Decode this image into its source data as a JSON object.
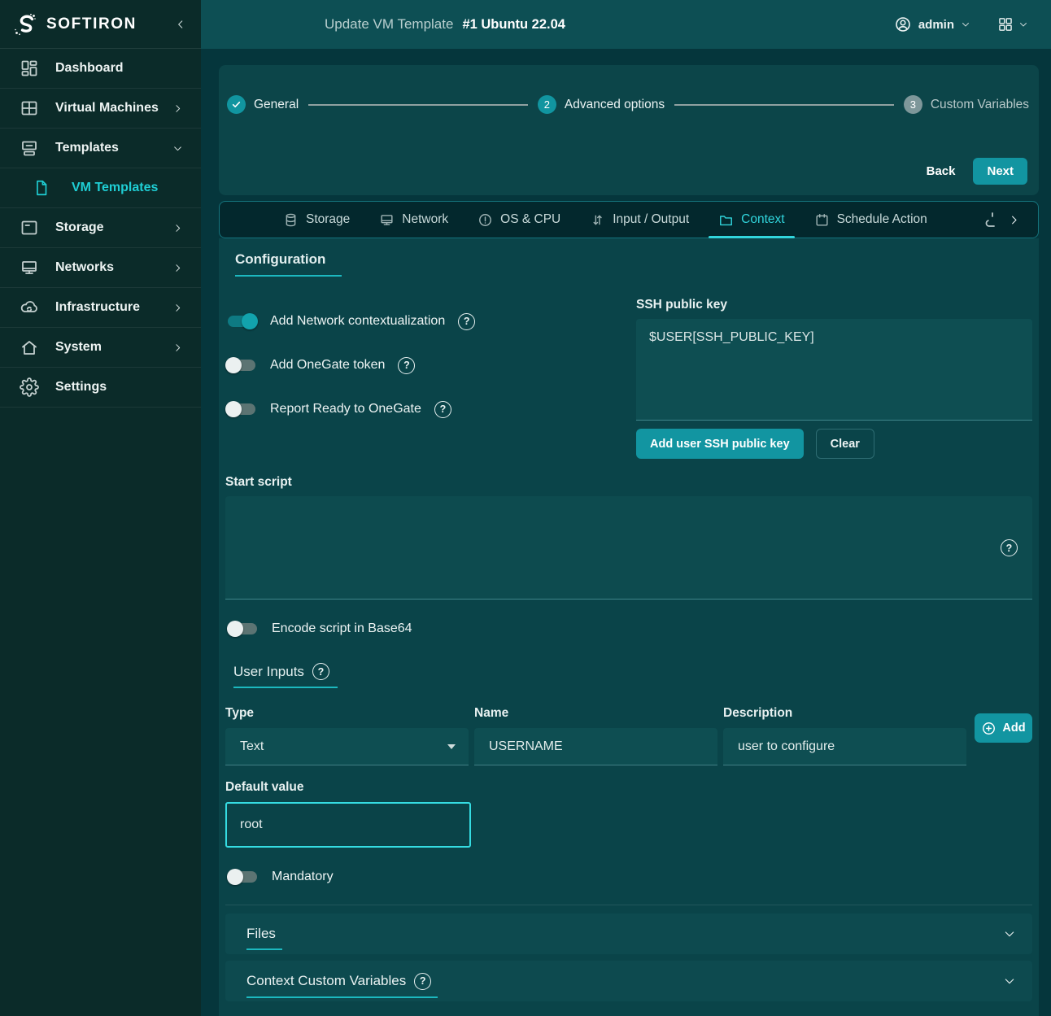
{
  "colors": {
    "accent": "#1295a1",
    "accent_bright": "#31d5dc",
    "focus_border": "#35dce2",
    "underline": "#1cb8bf",
    "sidebar_bg": "#0b2b29",
    "header_bg": "#0d4f54",
    "page_bg": "#05363c",
    "panel_bg": "#0a4449",
    "tabbar_bg": "#03282d"
  },
  "sidebar": {
    "brand": "SOFTIRON",
    "items": [
      {
        "label": "Dashboard",
        "icon": "dashboard-icon",
        "expandable": false,
        "active": false
      },
      {
        "label": "Virtual Machines",
        "icon": "vm-icon",
        "expandable": true,
        "active": false
      },
      {
        "label": "Templates",
        "icon": "templates-icon",
        "expandable": true,
        "expanded": true,
        "active": false
      },
      {
        "label": "VM Templates",
        "icon": "file-icon",
        "expandable": false,
        "active": true,
        "sub_item": true
      },
      {
        "label": "Storage",
        "icon": "storage-icon",
        "expandable": true,
        "active": false
      },
      {
        "label": "Networks",
        "icon": "networks-icon",
        "expandable": true,
        "active": false
      },
      {
        "label": "Infrastructure",
        "icon": "infrastructure-icon",
        "expandable": true,
        "active": false
      },
      {
        "label": "System",
        "icon": "system-icon",
        "expandable": true,
        "active": false
      },
      {
        "label": "Settings",
        "icon": "settings-icon",
        "expandable": false,
        "active": false
      }
    ]
  },
  "header": {
    "title": "Update VM Template",
    "template_id": "#1 Ubuntu 22.04",
    "user": "admin"
  },
  "wizard": {
    "steps": [
      {
        "num": "1",
        "label": "General",
        "state": "done"
      },
      {
        "num": "2",
        "label": "Advanced options",
        "state": "active"
      },
      {
        "num": "3",
        "label": "Custom Variables",
        "state": "pending"
      }
    ],
    "back_label": "Back",
    "next_label": "Next"
  },
  "tabs": {
    "items": [
      {
        "label": "Storage",
        "icon": "database-icon",
        "active": false
      },
      {
        "label": "Network",
        "icon": "monitor-icon",
        "active": false
      },
      {
        "label": "OS & CPU",
        "icon": "info-circle-icon",
        "active": false
      },
      {
        "label": "Input / Output",
        "icon": "arrows-updown-icon",
        "active": false
      },
      {
        "label": "Context",
        "icon": "folder-icon",
        "active": true
      },
      {
        "label": "Schedule Action",
        "icon": "calendar-icon",
        "active": false
      }
    ]
  },
  "context_tab": {
    "section_title": "Configuration",
    "toggles": [
      {
        "label": "Add Network contextualization",
        "on": true
      },
      {
        "label": "Add OneGate token",
        "on": false
      },
      {
        "label": "Report Ready to OneGate",
        "on": false
      }
    ],
    "ssh": {
      "label": "SSH public key",
      "value": "$USER[SSH_PUBLIC_KEY]",
      "add_button": "Add user SSH public key",
      "clear_button": "Clear"
    },
    "start_script": {
      "label": "Start script",
      "value": ""
    },
    "encode_toggle": {
      "label": "Encode script in Base64",
      "on": false
    },
    "user_inputs": {
      "title": "User Inputs",
      "type_label": "Type",
      "type_value": "Text",
      "name_label": "Name",
      "name_value": "USERNAME",
      "description_label": "Description",
      "description_value": "user to configure",
      "add_button": "Add",
      "default_label": "Default value",
      "default_value": "root",
      "mandatory_label": "Mandatory"
    },
    "sections": [
      {
        "title": "Files"
      },
      {
        "title": "Context Custom Variables"
      }
    ]
  }
}
